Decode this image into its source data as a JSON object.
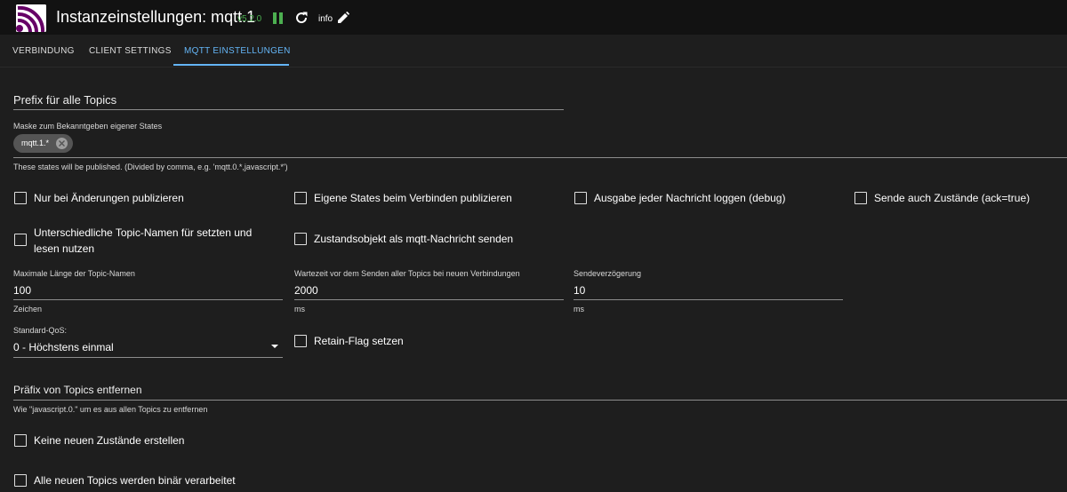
{
  "header": {
    "title": "Instanzeinstellungen: mqtt.1",
    "version": "v5.2.0",
    "info_label": "info",
    "accent": "#4caf50"
  },
  "tabs": [
    {
      "label": "VERBINDUNG"
    },
    {
      "label": "CLIENT SETTINGS"
    },
    {
      "label": "MQTT EINSTELLUNGEN",
      "active": true
    }
  ],
  "form": {
    "prefix": {
      "placeholder": "Prefix für alle Topics"
    },
    "mask": {
      "label": "Maske zum Bekanntgeben eigener States",
      "chip": "mqtt.1.*",
      "helper": "These states will be published. (Divided by comma, e.g. 'mqtt.0.*,javascript.*')"
    },
    "checkboxes_row1": [
      {
        "label": "Nur bei Änderungen publizieren",
        "checked": false
      },
      {
        "label": "Eigene States beim Verbinden publizieren",
        "checked": false
      },
      {
        "label": "Ausgabe jeder Nachricht loggen (debug)",
        "checked": false
      },
      {
        "label": "Sende auch Zustände (ack=true)",
        "checked": false
      }
    ],
    "checkboxes_row2": [
      {
        "label_line1": "Unterschiedliche Topic-Namen für setzten und",
        "label_line2": "lesen nutzen",
        "checked": false
      },
      {
        "label": "Zustandsobjekt als mqtt-Nachricht senden",
        "checked": false
      }
    ],
    "max_topic_length": {
      "label": "Maximale Länge der Topic-Namen",
      "value": "100",
      "helper": "Zeichen"
    },
    "wait_time": {
      "label": "Wartezeit vor dem Senden aller Topics bei neuen Verbindungen",
      "value": "2000",
      "helper": "ms"
    },
    "send_delay": {
      "label": "Sendeverzögerung",
      "value": "10",
      "helper": "ms"
    },
    "qos": {
      "label": "Standard-QoS:",
      "value": "0 - Höchstens einmal"
    },
    "retain": {
      "label": "Retain-Flag setzen",
      "checked": false
    },
    "remove_prefix": {
      "placeholder": "Präfix von Topics entfernen",
      "helper": "Wie \"javascript.0.\" um es aus allen Topics zu entfernen"
    },
    "no_new_states": {
      "label": "Keine neuen Zustände erstellen",
      "checked": false
    },
    "binary_topics": {
      "label": "Alle neuen Topics werden binär verarbeitet",
      "checked": false
    }
  }
}
